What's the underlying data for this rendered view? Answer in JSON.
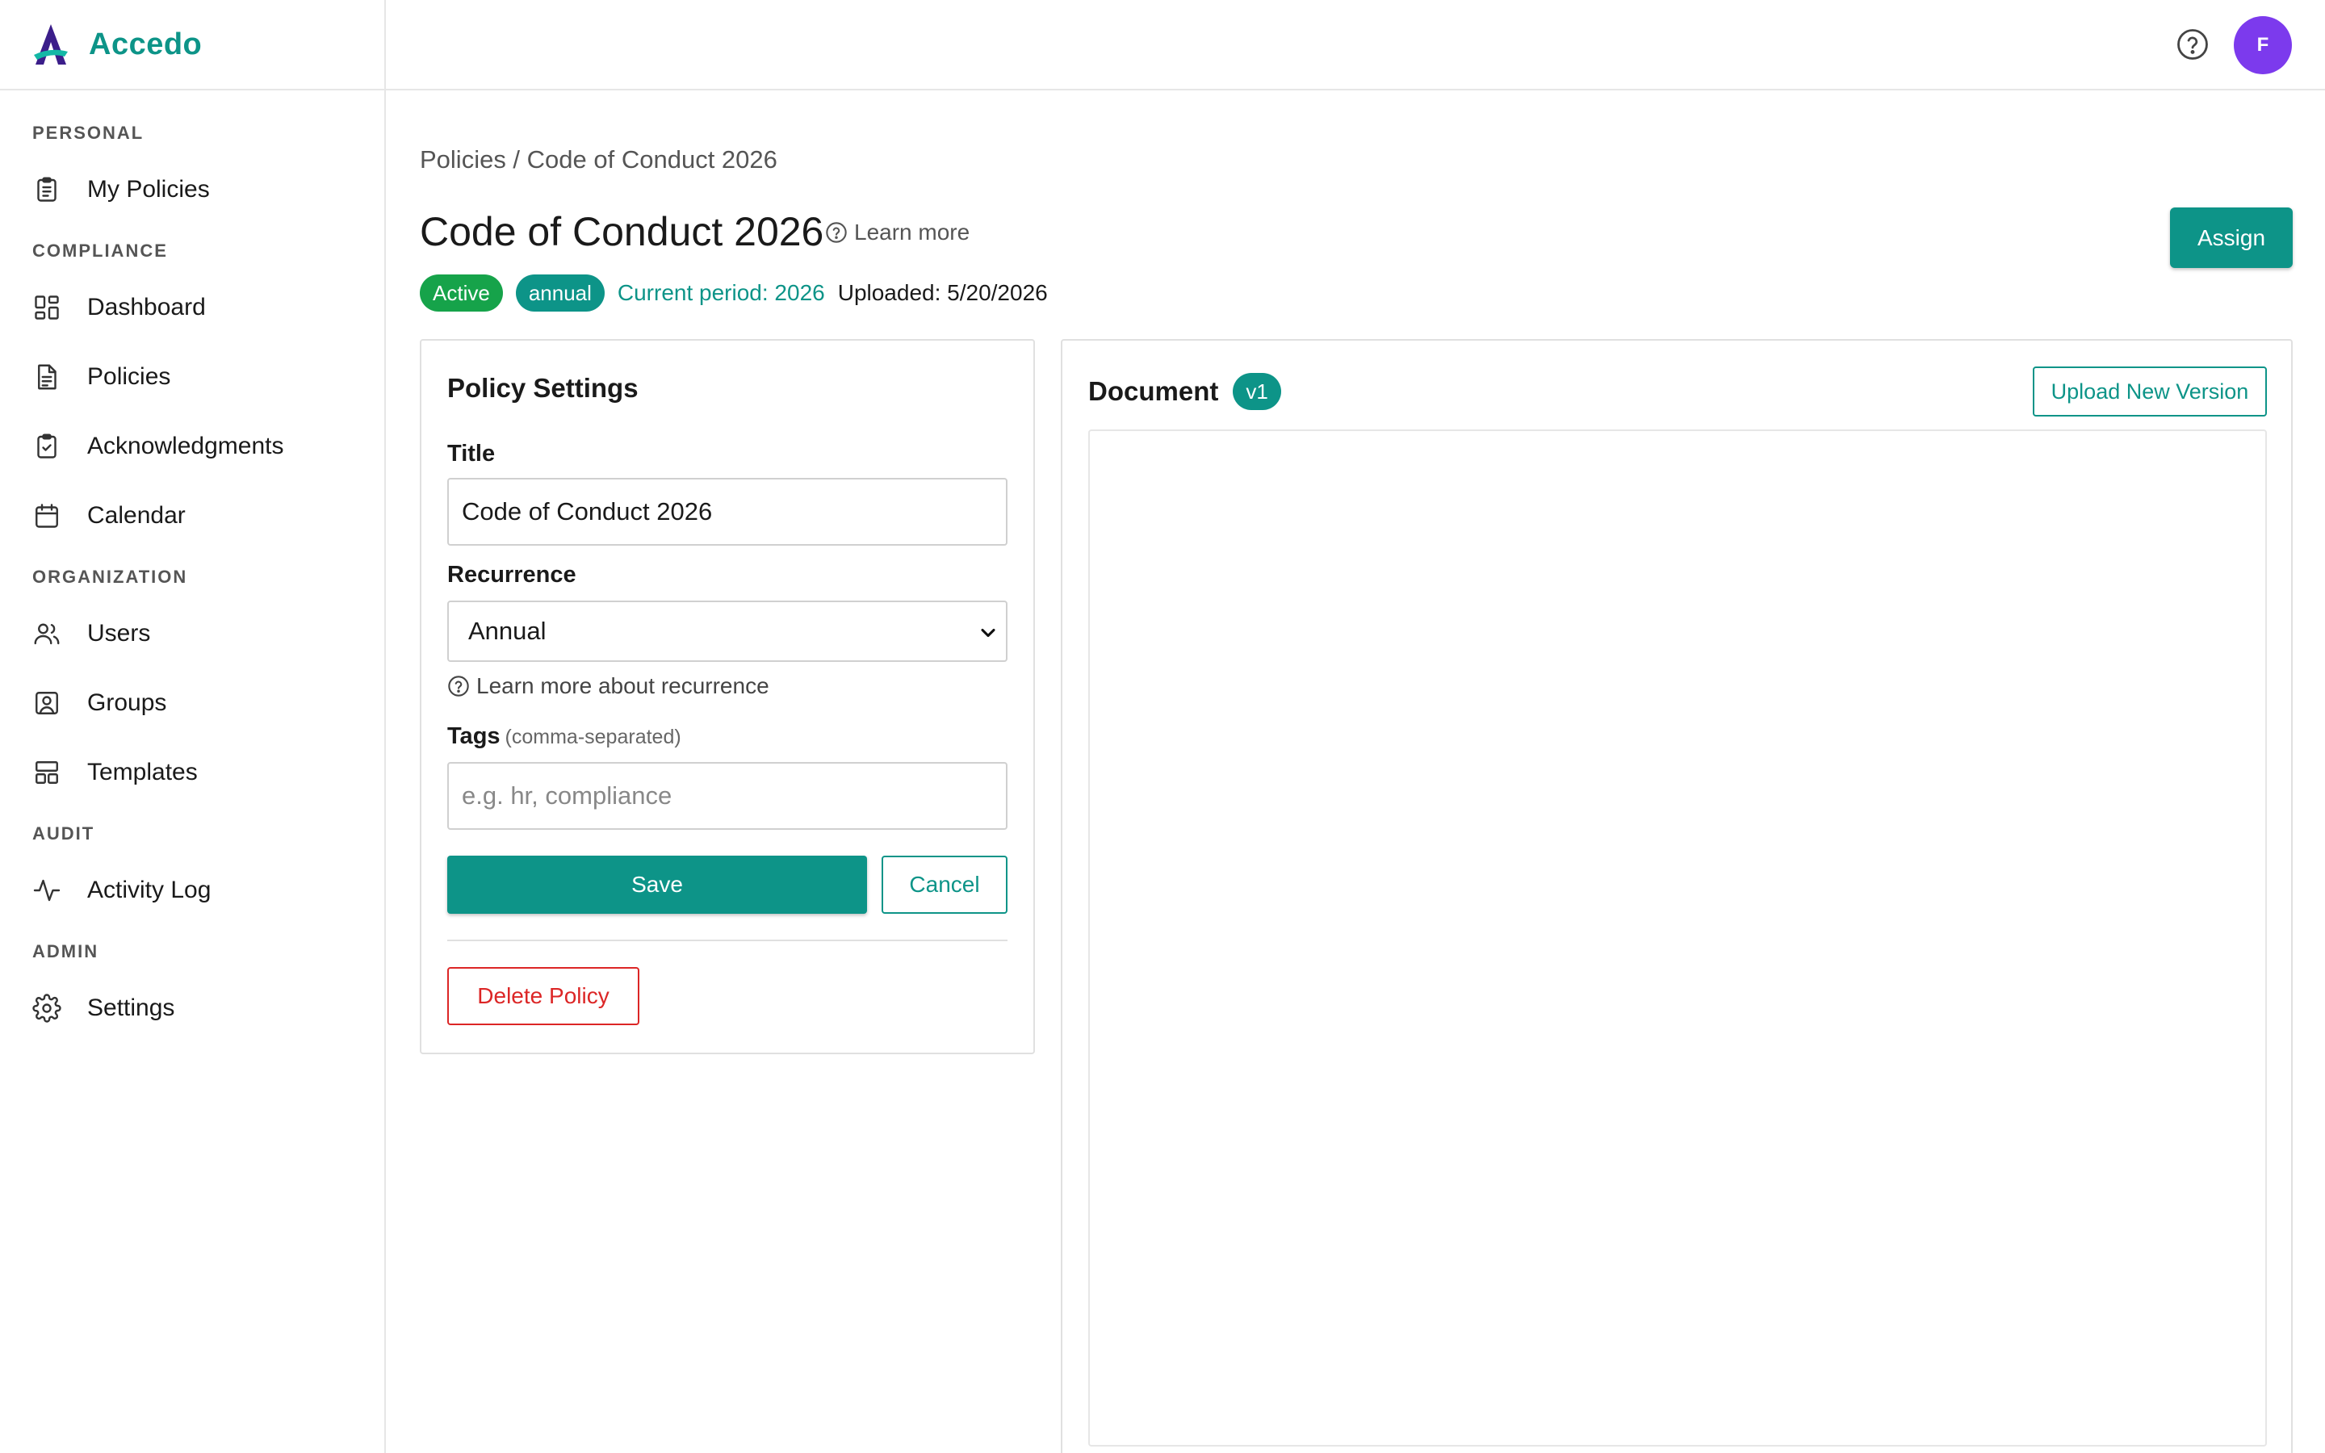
{
  "brand": {
    "name": "Accedo",
    "logo_icon": "accedo-logo",
    "colors": {
      "primary": "#0d9488",
      "logo_dark": "#3b1e8a",
      "logo_light": "#14b8a6"
    }
  },
  "sidebar": {
    "sections": [
      {
        "title": "PERSONAL",
        "items": [
          {
            "label": "My Policies",
            "icon": "clipboard-list-icon"
          }
        ]
      },
      {
        "title": "COMPLIANCE",
        "items": [
          {
            "label": "Dashboard",
            "icon": "dashboard-icon"
          },
          {
            "label": "Policies",
            "icon": "document-icon"
          },
          {
            "label": "Acknowledgments",
            "icon": "clipboard-check-icon"
          },
          {
            "label": "Calendar",
            "icon": "calendar-icon"
          }
        ]
      },
      {
        "title": "ORGANIZATION",
        "items": [
          {
            "label": "Users",
            "icon": "users-icon"
          },
          {
            "label": "Groups",
            "icon": "group-portrait-icon"
          },
          {
            "label": "Templates",
            "icon": "template-icon"
          }
        ]
      },
      {
        "title": "AUDIT",
        "items": [
          {
            "label": "Activity Log",
            "icon": "activity-icon"
          }
        ]
      },
      {
        "title": "ADMIN",
        "items": [
          {
            "label": "Settings",
            "icon": "gear-icon"
          }
        ]
      }
    ]
  },
  "topbar": {
    "help_icon": "help-circle-icon",
    "avatar_initial": "F",
    "avatar_color": "#7c3aed"
  },
  "header": {
    "breadcrumb": "Policies / Code of Conduct 2026",
    "title": "Code of Conduct 2026",
    "learn_more": "Learn more",
    "assign_label": "Assign"
  },
  "meta": {
    "status_badge": "Active",
    "status_color": "#16a34a",
    "recurrence_badge": "annual",
    "current_period": "Current period: 2026",
    "uploaded": "Uploaded: 5/20/2026"
  },
  "settings": {
    "card_title": "Policy Settings",
    "title_label": "Title",
    "title_value": "Code of Conduct 2026",
    "recurrence_label": "Recurrence",
    "recurrence_value": "Annual",
    "recurrence_help": "Learn more about recurrence",
    "tags_label": "Tags",
    "tags_hint": "(comma-separated)",
    "tags_placeholder": "e.g. hr, compliance",
    "tags_value": "",
    "save_label": "Save",
    "cancel_label": "Cancel",
    "delete_label": "Delete Policy",
    "danger_color": "#dc2626"
  },
  "document": {
    "title": "Document",
    "version": "v1",
    "upload_label": "Upload New Version"
  }
}
